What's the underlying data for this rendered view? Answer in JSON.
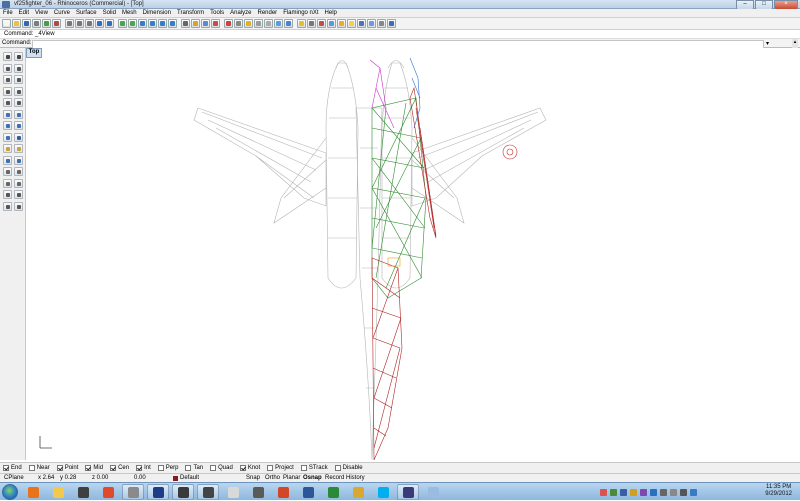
{
  "window": {
    "title": "vf25fighter_06 - Rhinoceros (Commercial) - [Top]",
    "buttons": {
      "minimize": "–",
      "maximize": "□",
      "close": "×"
    }
  },
  "menu": [
    "File",
    "Edit",
    "View",
    "Curve",
    "Surface",
    "Solid",
    "Mesh",
    "Dimension",
    "Transform",
    "Tools",
    "Analyze",
    "Render",
    "Flamingo nXt",
    "Help"
  ],
  "toolbar": {
    "icons": [
      "new-icon",
      "open-icon",
      "save-icon",
      "print-icon",
      "import-icon",
      "export-icon",
      "cut-icon",
      "copy-icon",
      "paste-icon",
      "undo-icon",
      "redo-icon",
      "pan-icon",
      "rotate-view-icon",
      "zoom-dynamic-icon",
      "zoom-window-icon",
      "zoom-extents-icon",
      "zoom-selected-icon",
      "select-icon",
      "layers-icon",
      "properties-icon",
      "object-snap-icon",
      "render-icon",
      "grid-icon",
      "lock-icon",
      "shade-icon",
      "wireframe-icon",
      "ghosted-icon",
      "rendered-icon",
      "light-icon",
      "camera-icon",
      "material-icon",
      "environment-icon",
      "sun-icon",
      "bulb-icon",
      "flamingo-icon",
      "render-view-icon",
      "options-icon",
      "help-icon"
    ],
    "icon_colors": [
      "#f5f5f5",
      "#e8c34a",
      "#3c63b0",
      "#7c7c7c",
      "#4a9a4a",
      "#b04a4a",
      "#777",
      "#777",
      "#777",
      "#2d6fc2",
      "#2d6fc2",
      "#4fa24f",
      "#4fa24f",
      "#3a7bc8",
      "#3a7bc8",
      "#3a7bc8",
      "#3a7bc8",
      "#666",
      "#d9a32a",
      "#5a8ad0",
      "#c94a4a",
      "#d04040",
      "#888",
      "#e0b030",
      "#9a9a9a",
      "#aaaaaa",
      "#5f9bd8",
      "#4c82d2",
      "#e6c02a",
      "#777",
      "#c0504d",
      "#5b9bd5",
      "#e8b020",
      "#f2d04a",
      "#4a76c0",
      "#6a9adf",
      "#888",
      "#3a6fb8"
    ]
  },
  "command": {
    "history": "Command: _4View",
    "label": "Command:",
    "input_value": ""
  },
  "left_toolbar": {
    "icons": [
      "select-arrow-icon",
      "point-icon",
      "polyline-icon",
      "curve-icon",
      "circle-icon",
      "arc-icon",
      "ellipse-icon",
      "rectangle-icon",
      "polygon-icon",
      "fillet-icon",
      "surface-icon",
      "extrude-icon",
      "box-icon",
      "sphere-icon",
      "mesh-icon",
      "boolean-icon",
      "split-icon",
      "trim-icon",
      "join-icon",
      "explode-icon",
      "move-icon",
      "rotate-icon",
      "scale-icon",
      "mirror-icon",
      "array-icon",
      "offset-icon",
      "dimension-icon",
      "text-icon"
    ],
    "icon_colors": [
      "#444",
      "#444",
      "#555",
      "#555",
      "#555",
      "#555",
      "#555",
      "#555",
      "#555",
      "#555",
      "#3f6fb5",
      "#3f6fb5",
      "#3f6fb5",
      "#3f6fb5",
      "#3f6fb5",
      "#2f5f9f",
      "#c8a23a",
      "#c8a23a",
      "#3a6fb0",
      "#3a6fb0",
      "#666",
      "#666",
      "#666",
      "#666",
      "#555",
      "#555",
      "#555",
      "#555"
    ]
  },
  "viewport": {
    "tab_label": "Top"
  },
  "osnap": [
    {
      "label": "End",
      "checked": true
    },
    {
      "label": "Near",
      "checked": false
    },
    {
      "label": "Point",
      "checked": true
    },
    {
      "label": "Mid",
      "checked": true
    },
    {
      "label": "Cen",
      "checked": true
    },
    {
      "label": "Int",
      "checked": true
    },
    {
      "label": "Perp",
      "checked": false
    },
    {
      "label": "Tan",
      "checked": false
    },
    {
      "label": "Quad",
      "checked": false
    },
    {
      "label": "Knot",
      "checked": true
    },
    {
      "label": "Project",
      "checked": false
    },
    {
      "label": "STrack",
      "checked": false
    },
    {
      "label": "Disable",
      "checked": false
    }
  ],
  "status": {
    "cplane": "CPlane",
    "x": "x 2.64",
    "y": "y 0.28",
    "z": "z 0.00",
    "extra": "0.00",
    "layer": "Default",
    "layer_color": "#8b1a1a",
    "toggles": [
      "Snap",
      "Ortho",
      "Planar",
      "Osnap",
      "Record History"
    ]
  },
  "taskbar": {
    "apps": [
      "firefox-icon",
      "explorer-icon",
      "media-player-icon",
      "html5-icon",
      "rhino-icon",
      "photoshop-icon",
      "steam-icon",
      "zbrush-icon",
      "file-icon",
      "winamp-icon",
      "powerpoint-icon",
      "word-icon",
      "paint-icon",
      "folder-icon",
      "skype-icon",
      "eye-app-icon",
      "document-icon"
    ],
    "app_colors": [
      "#e8731c",
      "#f2c94c",
      "#3f3f3f",
      "#e04a2a",
      "#8a8a8a",
      "#1f3c88",
      "#3a3a3a",
      "#444",
      "#d9d9d9",
      "#5a5a5a",
      "#d24726",
      "#2b579a",
      "#2a8a3a",
      "#d9a832",
      "#00aff0",
      "#3a3a7a",
      "#9bbbe0"
    ],
    "active_indices": [
      4,
      5,
      6,
      7,
      15
    ]
  },
  "tray": {
    "icon_colors": [
      "#d9534f",
      "#4a8a3a",
      "#3a5fa0",
      "#d0a020",
      "#7a4ab0",
      "#2b70c0",
      "#666",
      "#888",
      "#555",
      "#3a7ac0"
    ]
  },
  "clock": {
    "time": "11:35 PM",
    "date": "9/29/2012"
  }
}
